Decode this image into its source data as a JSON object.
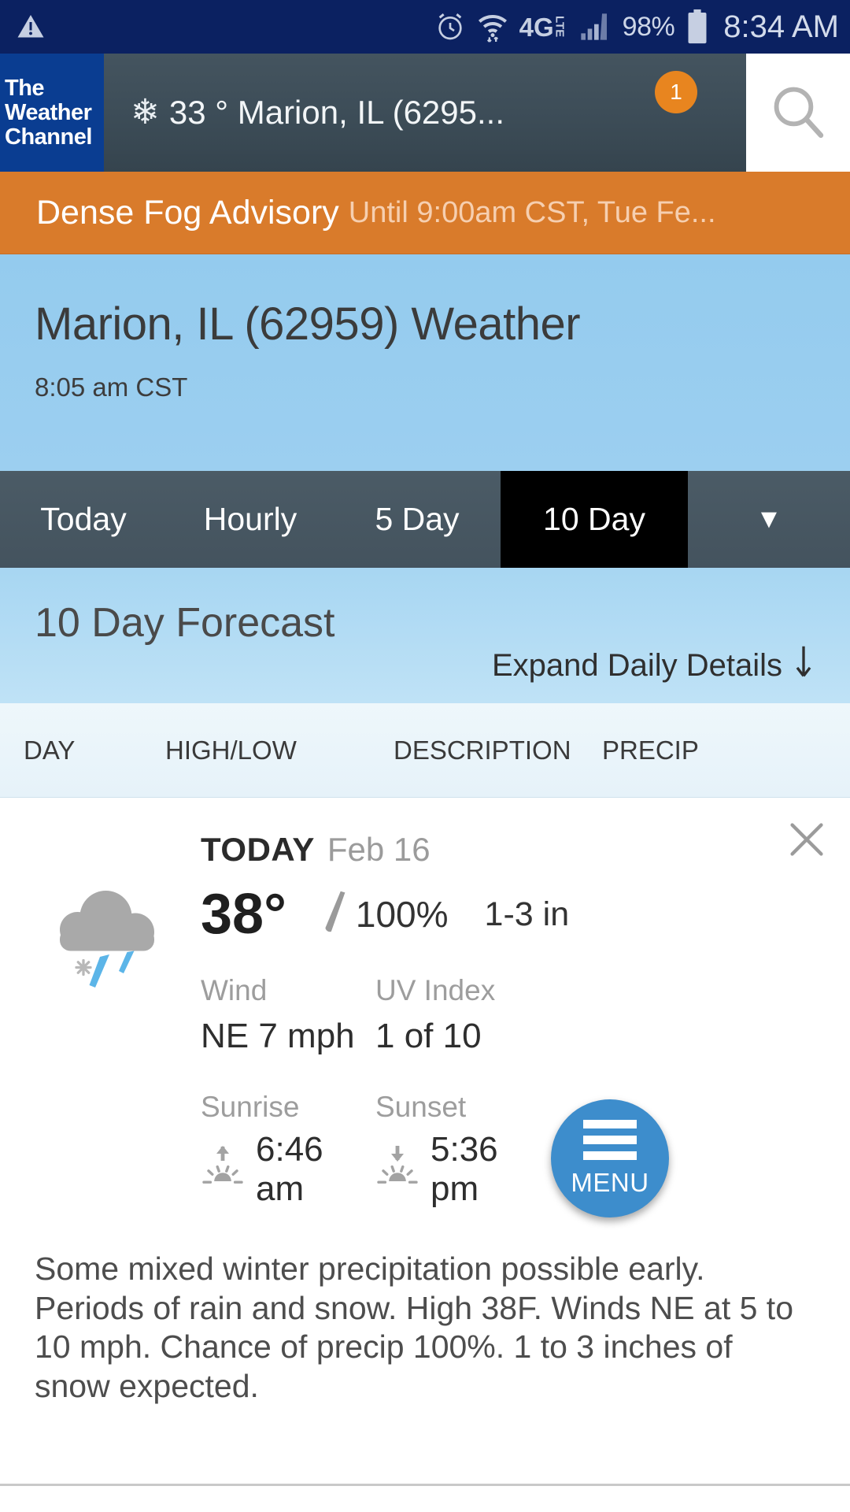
{
  "status_bar": {
    "warning_icon": "warning-triangle-icon",
    "alarm_icon": "alarm-clock-icon",
    "wifi_icon": "wifi-icon",
    "network_label": "4G",
    "network_sub": "LTE",
    "signal_icon": "cellular-signal-icon",
    "battery_percent": "98%",
    "battery_icon": "battery-icon",
    "clock": "8:34 AM"
  },
  "app_bar": {
    "logo_line1": "The",
    "logo_line2": "Weather",
    "logo_line3": "Channel",
    "condition_icon": "snowflake-icon",
    "location_summary": "33 ° Marion, IL (6295...",
    "badge_count": "1",
    "search_icon": "search-icon"
  },
  "alert": {
    "title": "Dense Fog Advisory",
    "subtitle": "Until 9:00am CST, Tue Fe..."
  },
  "hero": {
    "title": "Marion, IL (62959) Weather",
    "observed_time": "8:05 am CST"
  },
  "tabs": {
    "items": [
      {
        "label": "Today",
        "active": false
      },
      {
        "label": "Hourly",
        "active": false
      },
      {
        "label": "5 Day",
        "active": false
      },
      {
        "label": "10 Day",
        "active": true
      }
    ],
    "more_icon": "chevron-down-icon"
  },
  "forecast_header": {
    "title": "10 Day Forecast",
    "expand_label": "Expand Daily Details",
    "expand_icon": "arrow-down-icon"
  },
  "column_headers": {
    "day": "DAY",
    "high_low": "HIGH/LOW",
    "description": "DESCRIPTION",
    "precip": "PRECIP"
  },
  "detail_card": {
    "close_icon": "close-icon",
    "weather_icon": "cloud-rain-snow-icon",
    "day_label": "TODAY",
    "date": "Feb 16",
    "temperature": "38°",
    "precip_icon": "raindrop-icon",
    "precip_chance": "100%",
    "accumulation": "1-3 in",
    "wind_label": "Wind",
    "wind_value": "NE 7 mph",
    "uv_label": "UV Index",
    "uv_value": "1 of 10",
    "sunrise_label": "Sunrise",
    "sunrise_icon": "sunrise-icon",
    "sunrise_value": "6:46 am",
    "sunset_label": "Sunset",
    "sunset_icon": "sunset-icon",
    "sunset_value": "5:36 pm",
    "narrative": "Some mixed winter precipitation possible early. Periods of rain and snow. High 38F. Winds NE at 5 to 10 mph. Chance of precip 100%. 1 to 3 inches of snow expected."
  },
  "fab": {
    "icon": "hamburger-menu-icon",
    "label": "MENU"
  },
  "colors": {
    "status_bar": "#0b2161",
    "brand_blue": "#0a3d91",
    "alert_orange": "#d97b2b",
    "badge_orange": "#e8851f",
    "sky_blue": "#94cbee",
    "tab_bar": "#4b5b66",
    "active_tab": "#000000",
    "fab_blue": "#3d8dcc"
  }
}
